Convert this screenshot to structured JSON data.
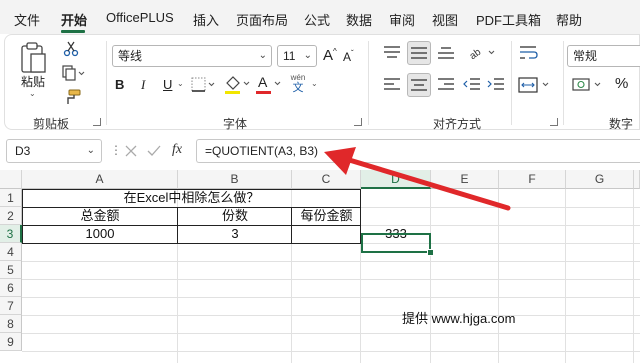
{
  "menu": {
    "items": [
      "文件",
      "开始",
      "OfficePLUS",
      "插入",
      "页面布局",
      "公式",
      "数据",
      "审阅",
      "视图",
      "PDF工具箱",
      "帮助"
    ],
    "active": "开始"
  },
  "ribbon": {
    "clipboard": {
      "paste_label": "粘贴",
      "group_label": "剪贴板"
    },
    "font": {
      "font_name": "等线",
      "font_size": "11",
      "bold": "B",
      "italic": "I",
      "underline": "U",
      "font_color_letter": "A",
      "wen_label": "wén",
      "wen_char": "文",
      "group_label": "字体"
    },
    "alignment": {
      "group_label": "对齐方式"
    },
    "number": {
      "format": "常规",
      "percent": "%",
      "group_label": "数字"
    }
  },
  "formula_bar": {
    "name_box": "D3",
    "fx": "fx",
    "formula": "=QUOTIENT(A3, B3)"
  },
  "sheet": {
    "columns": [
      "A",
      "B",
      "C",
      "D",
      "E",
      "F",
      "G"
    ],
    "rows": [
      "1",
      "2",
      "3",
      "4",
      "5",
      "6",
      "7",
      "8",
      "9"
    ],
    "title": "在Excel中相除怎么做？",
    "headers": {
      "A2": "总金额",
      "B2": "份数",
      "C2": "每份金额"
    },
    "values": {
      "A3": "1000",
      "B3": "3",
      "D3": "333"
    },
    "active_cell": "D3",
    "watermark": "提供 www.hjga.com"
  },
  "accent_color": "#1e7145",
  "arrow_color": "#e0282a"
}
